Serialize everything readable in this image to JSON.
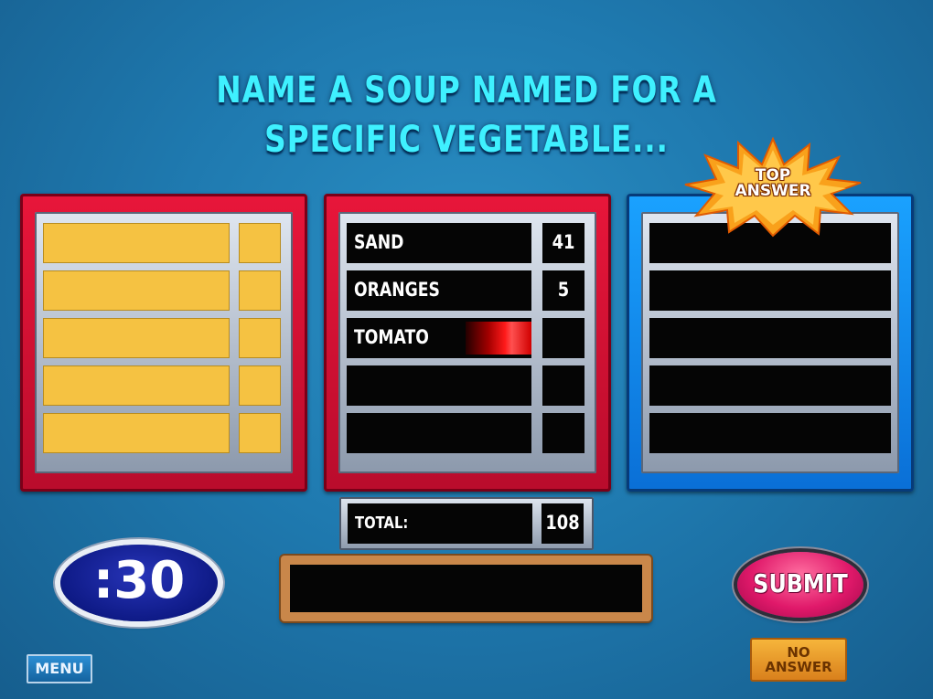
{
  "question": {
    "line1": "NAME A SOUP NAMED FOR A",
    "line2": "SPECIFIC VEGETABLE..."
  },
  "badge": {
    "line1": "TOP",
    "line2": "ANSWER"
  },
  "answers": [
    {
      "text": "SAND",
      "points": "41"
    },
    {
      "text": "ORANGES",
      "points": "5"
    },
    {
      "text": "TOMATO",
      "points": ""
    },
    {
      "text": "",
      "points": ""
    },
    {
      "text": "",
      "points": ""
    }
  ],
  "total": {
    "label": "TOTAL:",
    "value": "108"
  },
  "answer_input": {
    "value": ""
  },
  "timer": ":30",
  "buttons": {
    "submit": "SUBMIT",
    "menu": "MENU",
    "no_answer_line1": "NO",
    "no_answer_line2": "ANSWER"
  },
  "colors": {
    "question": "#3ff0ff",
    "board_left": "#e8163a",
    "board_center": "#e8163a",
    "board_right": "#1aa2ff",
    "tile_covered": "#f5c242",
    "tile_revealed": "#050505"
  },
  "icons": {
    "top_answer_badge": "starburst"
  }
}
